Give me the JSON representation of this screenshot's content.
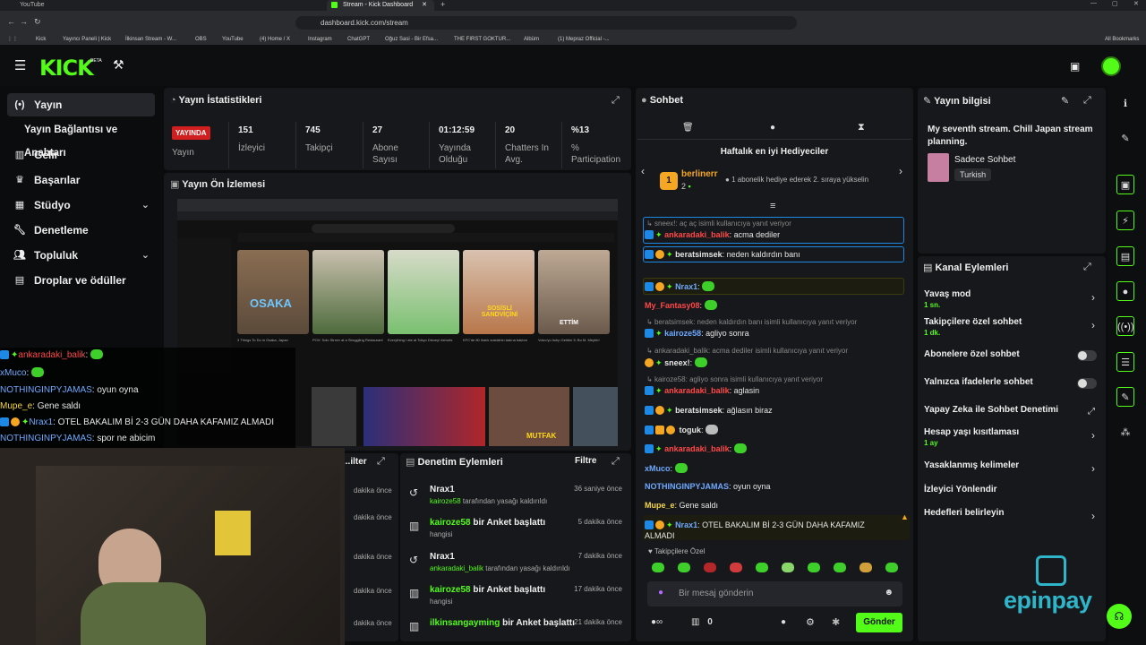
{
  "browser": {
    "tabs": [
      {
        "label": "YouTube"
      },
      {
        "label": "Stream - Kick Dashboard"
      }
    ],
    "url": "dashboard.kick.com/stream",
    "bookmarks": [
      "Kick",
      "Yayıncı Paneli | Kick",
      "İlkinsan Stream - W...",
      "OBS",
      "YouTube",
      "(4) Home / X",
      "Instagram",
      "ChatGPT",
      "Oğuz Sasi - Bir Efsa...",
      "THE FIRST GOKTUR...",
      "Albüm",
      "(1) Mepraz Official -..."
    ],
    "all_bookmarks": "All Bookmarks"
  },
  "header": {
    "logo": "KICK",
    "beta": "BETA"
  },
  "sidebar": {
    "items": [
      {
        "label": "Yayın",
        "icon": "broadcast-icon",
        "active": true
      },
      {
        "label": "Yayın Bağlantısı ve Anahtarı",
        "icon": ""
      },
      {
        "label": "Gelir",
        "icon": "revenue-icon"
      },
      {
        "label": "Başarılar",
        "icon": "trophy-icon"
      },
      {
        "label": "Stüdyo",
        "icon": "studio-icon",
        "chevron": true
      },
      {
        "label": "Denetleme",
        "icon": "wrench-icon"
      },
      {
        "label": "Topluluk",
        "icon": "community-icon",
        "chevron": true
      },
      {
        "label": "Droplar ve ödüller",
        "icon": "gift-icon"
      }
    ]
  },
  "stats": {
    "title": "Yayın İstatistikleri",
    "live_badge": "YAYINDA",
    "live_label": "Yayın",
    "items": [
      {
        "value": "151",
        "label": "İzleyici"
      },
      {
        "value": "745",
        "label": "Takipçi"
      },
      {
        "value": "27",
        "label": "Abone Sayısı"
      },
      {
        "value": "01:12:59",
        "label": "Yayında Olduğu"
      },
      {
        "value": "20",
        "label": "Chatters In Avg."
      },
      {
        "value": "%13",
        "label": "% Participation"
      }
    ]
  },
  "preview": {
    "title": "Yayın Ön İzlemesi",
    "thumb_labels": [
      "OSAKA",
      "SOSİSLİ SANDVİÇİNİ",
      "ETTİM",
      "MUTFAK"
    ],
    "thumb_titles": [
      "3 Things To Do in Osaka, Japan",
      "POV: Solo Strrrer at a Struggling Restaurant",
      "Everything I ate at Tokyo Disney! #shorts",
      "KFC'de 80 liralık sosislinin tadına baktım",
      "Volvo'yu Isıtıp Geldim 5: Bu M. Meyhtı!"
    ]
  },
  "overlay_chat": [
    {
      "user": "ankaradaki_balik",
      "text": ":",
      "color": "red",
      "emote": true,
      "badges": 2
    },
    {
      "user": "xMuco",
      "text": ":",
      "color": "blue",
      "emote": true,
      "badges": 0
    },
    {
      "user": "NOTHINGINPYJAMAS",
      "text": ": oyun oyna",
      "color": "blue",
      "emote": false,
      "badges": 0
    },
    {
      "user": "Mupe_e",
      "text": ": Gene saldı",
      "color": "yellow",
      "emote": false,
      "badges": 0
    },
    {
      "user": "Nrax1",
      "text": ": OTEL BAKALIM Bİ 2-3 GÜN DAHA KAFAMIZ ALMADI",
      "color": "blue",
      "emote": false,
      "badges": 3
    },
    {
      "user": "NOTHINGINPYJAMAS",
      "text": ": spor ne abicim",
      "color": "blue",
      "emote": false,
      "badges": 0
    }
  ],
  "mod_actions_left": {
    "title": "...ilter",
    "filter": "Filtre",
    "times": [
      "dakika önce",
      "dakika önce",
      "dakika önce",
      "dakika önce",
      "dakika önce"
    ]
  },
  "mod_actions": {
    "title": "Denetim Eylemleri",
    "filter": "Filtre",
    "items": [
      {
        "icon": "undo-icon",
        "name": "Nrax1",
        "detail_user": "kairoze58",
        "detail": " tarafından yasağı kaldırıldı",
        "time": "36 saniye önce"
      },
      {
        "icon": "poll-icon",
        "name": "kairoze58",
        "action": " bir Anket başlattı",
        "detail": "hangisi",
        "time": "5 dakika önce"
      },
      {
        "icon": "undo-icon",
        "name": "Nrax1",
        "detail_user": "ankaradaki_balik",
        "detail": " tarafından yasağı kaldırıldı",
        "time": "7 dakika önce"
      },
      {
        "icon": "poll-icon",
        "name": "kairoze58",
        "action": " bir Anket başlattı",
        "detail": "hangisi",
        "time": "17 dakika önce"
      },
      {
        "icon": "poll-icon",
        "name": "ilkinsangayming",
        "action": " bir Anket başlattı",
        "detail": "",
        "time": "21 dakika önce"
      }
    ]
  },
  "chat": {
    "title": "Sohbet",
    "top_gifters_title": "Haftalık en iyi Hediyeciler",
    "gifter": {
      "name": "berlinerr",
      "count": "2",
      "rank": "1",
      "note": "1 abonelik hediye ederek 2. sıraya yükselin"
    },
    "messages": [
      {
        "reply": "sneex!: aç aç isimli kullanıcıya yanıt veriyor"
      },
      {
        "user": "ankaradaki_balik",
        "text": ": acma dediler",
        "color": "red",
        "box": true
      },
      {
        "user": "beratsimsek",
        "text": ": neden kaldırdın banı",
        "color": "white",
        "box": true
      },
      {
        "user": "Nrax1",
        "text": ":",
        "color": "blue",
        "emote": true,
        "box": true
      },
      {
        "user": "My_Fantasy08",
        "text": ":",
        "color": "red",
        "emote": true
      },
      {
        "reply": "beratsimsek: neden kaldırdın banı isimli kullanıcıya yanıt veriyor"
      },
      {
        "user": "kairoze58",
        "text": ": agliyo sonra",
        "color": "blue"
      },
      {
        "reply": "ankaradaki_balik: acma dediler isimli kullanıcıya yanıt veriyor"
      },
      {
        "user": "sneex!",
        "text": ":",
        "color": "white",
        "emote": true
      },
      {
        "reply": "kairoze58: agliyo sonra isimli kullanıcıya yanıt veriyor"
      },
      {
        "user": "ankaradaki_balik",
        "text": ": aglasin",
        "color": "red"
      },
      {
        "user": "beratsimsek",
        "text": ": ağlasın biraz",
        "color": "white"
      },
      {
        "user": "toguk",
        "text": ":",
        "color": "white",
        "emote": true
      },
      {
        "user": "ankaradaki_balik",
        "text": ":",
        "color": "red",
        "emote": true
      },
      {
        "user": "xMuco",
        "text": ":",
        "color": "blue",
        "emote": true
      },
      {
        "user": "NOTHINGINPYJAMAS",
        "text": ": oyun oyna",
        "color": "blue"
      },
      {
        "user": "Mupe_e",
        "text": ": Gene saldı",
        "color": "yellow"
      },
      {
        "user": "Nrax1",
        "text": ": OTEL BAKALIM Bİ 2-3 GÜN DAHA KAFAMIZ ALMADI",
        "color": "blue"
      }
    ],
    "followers_only": "Takipçilere Özel",
    "input_placeholder": "Bir mesaj gönderin",
    "points": "0",
    "send": "Gönder"
  },
  "stream_info": {
    "title": "Yayın bilgisi",
    "stream_title": "My seventh stream. Chill Japan stream planning.",
    "category": "Sadece Sohbet",
    "language": "Turkish"
  },
  "channel_actions": {
    "title": "Kanal Eylemleri",
    "items": [
      {
        "label": "Yavaş mod",
        "sub": "1 sn.",
        "type": "chevron"
      },
      {
        "label": "Takipçilere özel sohbet",
        "sub": "1 dk.",
        "type": "chevron"
      },
      {
        "label": "Abonelere özel sohbet",
        "sub": "",
        "type": "toggle"
      },
      {
        "label": "Yalnızca ifadelerle sohbet",
        "sub": "",
        "type": "toggle"
      },
      {
        "label": "Yapay Zeka ile Sohbet Denetimi",
        "sub": "",
        "type": "external"
      },
      {
        "label": "Hesap yaşı kısıtlaması",
        "sub": "1 ay",
        "type": "chevron"
      },
      {
        "label": "Yasaklanmış kelimeler",
        "sub": "",
        "type": "chevron"
      },
      {
        "label": "İzleyici Yönlendir",
        "sub": "",
        "type": "none"
      },
      {
        "label": "Hedefleri belirleyin",
        "sub": "",
        "type": "chevron"
      }
    ],
    "watermark": "epinpay"
  },
  "colors": {
    "accent": "#53fc18",
    "live": "#d11f1f",
    "panel": "#17181b",
    "bg": "#0b0c0d"
  }
}
